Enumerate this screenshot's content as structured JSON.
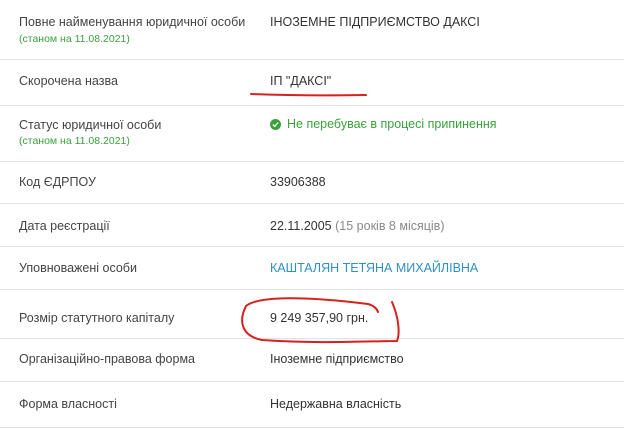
{
  "rows": [
    {
      "label": "Повне найменування юридичної особи",
      "sublabel": "(станом на 11.08.2021)",
      "value": "ІНОЗЕМНЕ ПІДПРИЄМСТВО ДАКСІ"
    },
    {
      "label": "Скорочена назва",
      "value": "ІП \"ДАКСІ\""
    },
    {
      "label": "Статус юридичної особи",
      "sublabel": "(станом на 11.08.2021)",
      "value": "Не перебуває в процесі припинення"
    },
    {
      "label": "Код ЄДРПОУ",
      "value": "33906388"
    },
    {
      "label": "Дата реєстрації",
      "value": "22.11.2005",
      "extra": "(15 років 8 місяців)"
    },
    {
      "label": "Уповноважені особи",
      "value": "КАШТАЛЯН ТЕТЯНА МИХАЙЛІВНА"
    },
    {
      "label": "Розмір статутного капіталу",
      "value": "9 249 357,90 грн."
    },
    {
      "label": "Організаційно-правова форма",
      "value": "Іноземне підприємство"
    },
    {
      "label": "Форма власності",
      "value": "Недержавна власність"
    }
  ],
  "colors": {
    "accent_green": "#39a13a",
    "link_blue": "#2f8fc7",
    "annotation_red": "#d9201f"
  }
}
